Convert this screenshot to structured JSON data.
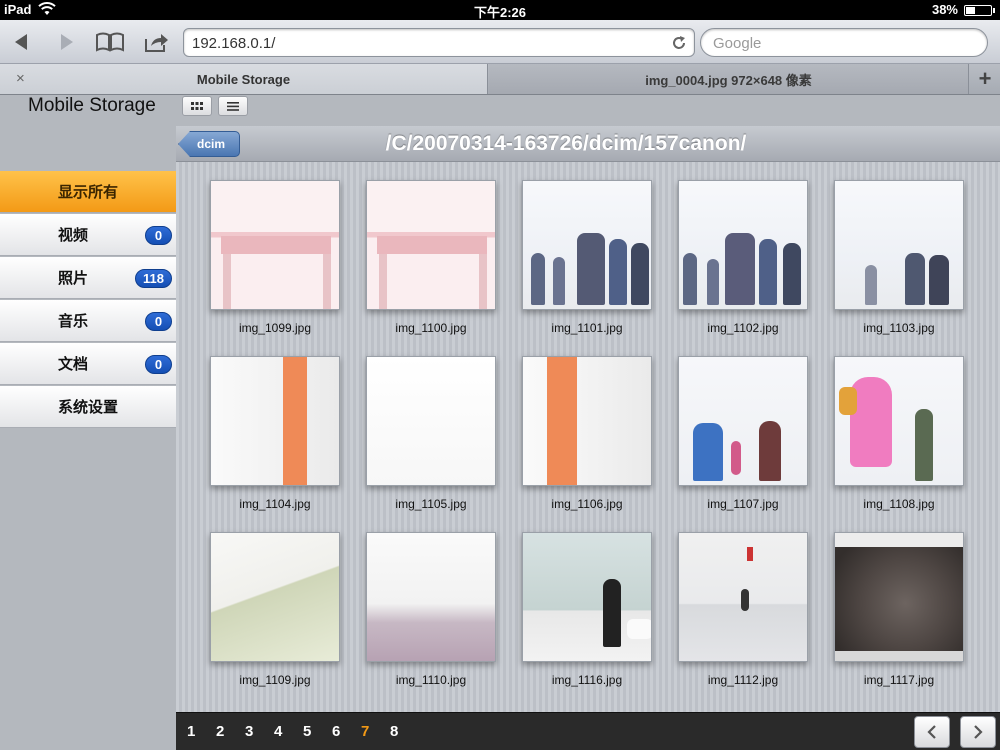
{
  "status_bar": {
    "device": "iPad",
    "time": "下午2:26",
    "battery_text": "38%",
    "battery_level": 0.38
  },
  "toolbar": {
    "url": "192.168.0.1/",
    "search_placeholder": "Google"
  },
  "tabs": [
    {
      "label": "Mobile Storage",
      "active": true
    },
    {
      "label": "img_0004.jpg 972×648 像素",
      "active": false
    }
  ],
  "app": {
    "title": "Mobile Storage"
  },
  "sidebar": {
    "items": [
      {
        "label": "显示所有",
        "badge": null,
        "active": true
      },
      {
        "label": "视频",
        "badge": "0"
      },
      {
        "label": "照片",
        "badge": "118"
      },
      {
        "label": "音乐",
        "badge": "0"
      },
      {
        "label": "文档",
        "badge": "0"
      },
      {
        "label": "系统设置",
        "badge": null
      }
    ]
  },
  "content": {
    "back_label": "dcim",
    "path": "/C/20070314-163726/dcim/157canon/",
    "images": [
      {
        "name": "img_1099.jpg"
      },
      {
        "name": "img_1100.jpg"
      },
      {
        "name": "img_1101.jpg"
      },
      {
        "name": "img_1102.jpg"
      },
      {
        "name": "img_1103.jpg"
      },
      {
        "name": "img_1104.jpg"
      },
      {
        "name": "img_1105.jpg"
      },
      {
        "name": "img_1106.jpg"
      },
      {
        "name": "img_1107.jpg"
      },
      {
        "name": "img_1108.jpg"
      },
      {
        "name": "img_1109.jpg"
      },
      {
        "name": "img_1110.jpg"
      },
      {
        "name": "img_1116.jpg"
      },
      {
        "name": "img_1112.jpg"
      },
      {
        "name": "img_1117.jpg"
      }
    ]
  },
  "pager": {
    "pages": [
      "1",
      "2",
      "3",
      "4",
      "5",
      "6",
      "7",
      "8"
    ],
    "current": "7"
  },
  "colors": {
    "accent": "#f39a16",
    "badge": "#1f5ec4"
  }
}
